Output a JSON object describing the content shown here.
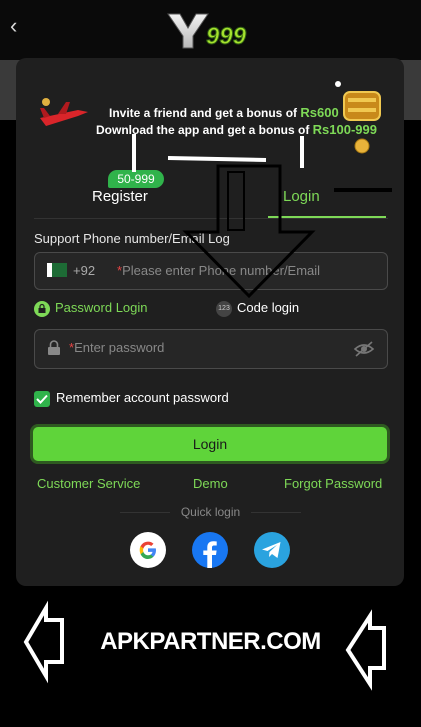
{
  "header": {
    "back_glyph": "‹",
    "logo_text": "Y999"
  },
  "promo": {
    "line1_prefix": "Invite a friend and get a bonus of ",
    "line1_amount": "Rs600",
    "line2_prefix": "Download the app and get a bonus of ",
    "line2_amount": "Rs100-999"
  },
  "tabs": {
    "badge": "50-999",
    "register": "Register",
    "login": "Login"
  },
  "form": {
    "phone_label": "Support Phone number/Email Log",
    "country_code": "+92",
    "phone_required_mark": "*",
    "phone_placeholder": "Please enter Phone number/Email",
    "password_login": "Password Login",
    "code_icon_text": "123",
    "code_login": "Code login",
    "password_required_mark": "*",
    "password_placeholder": "Enter password",
    "remember": "Remember account password",
    "login_button": "Login"
  },
  "links": {
    "customer_service": "Customer Service",
    "demo": "Demo",
    "forgot": "Forgot Password"
  },
  "quick_login": {
    "label": "Quick login",
    "providers": [
      "google-icon",
      "facebook-icon",
      "telegram-icon"
    ]
  },
  "footer": {
    "watermark": "APKPARTNER.COM"
  },
  "colors": {
    "accent": "#7ed957",
    "button": "#5fd43a",
    "card": "#1f1f1f",
    "badge": "#30b34b",
    "facebook": "#1877f2",
    "telegram": "#2aa3df"
  }
}
